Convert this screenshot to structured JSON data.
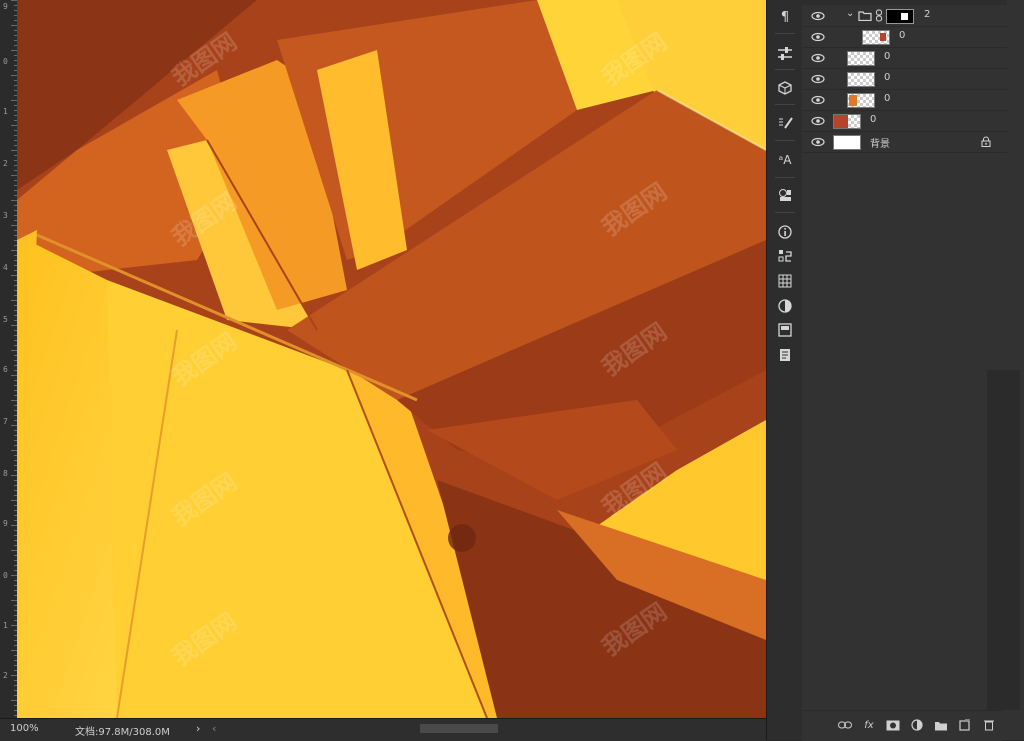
{
  "status": {
    "zoom": "100%",
    "doc_info": "文档:97.8M/308.0M",
    "expand_arrow": "›",
    "scroll_left": "‹"
  },
  "ruler": {
    "labels": [
      "9",
      "0",
      "1",
      "2",
      "3",
      "4",
      "5",
      "6",
      "7",
      "8",
      "9",
      "0",
      "1",
      "2"
    ]
  },
  "watermark": "我图网",
  "layers": [
    {
      "name": "2",
      "type": "group"
    },
    {
      "name": "0",
      "type": "layer-image"
    },
    {
      "name": "0",
      "type": "layer-transparent"
    },
    {
      "name": "0",
      "type": "layer-transparent"
    },
    {
      "name": "0",
      "type": "layer-image-small"
    },
    {
      "name": "0",
      "type": "layer-red"
    },
    {
      "name": "背景",
      "type": "background"
    }
  ],
  "tools": [
    "paragraph-icon",
    "adjust-sliders-icon",
    "3d-cube-icon",
    "brush-presets-icon",
    "character-styles-icon",
    "clone-source-icon",
    "info-icon",
    "history-icon",
    "grid-icon",
    "adjustments-icon",
    "properties-icon",
    "notes-icon"
  ],
  "colors": {
    "canvas_orange": "#f08a1c",
    "canvas_yellow": "#ffcd2a",
    "canvas_shadow": "#a8421a",
    "panel_bg": "#323232",
    "layer_red_thumb": "#b4452c"
  }
}
